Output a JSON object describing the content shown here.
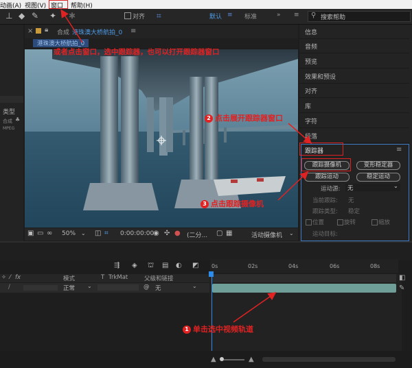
{
  "menu": {
    "animation": "动画(A)",
    "view": "视图(V)",
    "window": "窗口",
    "help": "帮助(H)"
  },
  "toolbar": {
    "align_label": "对齐",
    "workspace_default": "默认",
    "workspace_standard": "标准",
    "search_placeholder": "搜索帮助"
  },
  "project": {
    "type_label": "类型",
    "synth_label": "合成",
    "mp4_label": "MPEG"
  },
  "composition": {
    "tab_prefix": "合成",
    "tab_title": "港珠澳大桥航拍_0",
    "subtab": "港珠澳大桥航拍_0",
    "zoom": "50%",
    "timecode": "0:00:00:00",
    "resolution": "(二分...",
    "camera": "活动摄像机"
  },
  "right_panel": {
    "items": [
      "信息",
      "音频",
      "预览",
      "效果和预设",
      "对齐",
      "库",
      "字符",
      "段落"
    ],
    "tracker": {
      "title": "跟踪器",
      "btn_track_camera": "跟踪摄像机",
      "btn_warp_stabilizer": "变形稳定器",
      "btn_track_motion": "跟踪运动",
      "btn_stabilize_motion": "稳定运动",
      "motion_source_label": "运动源:",
      "motion_source_value": "无",
      "current_track_label": "当前跟踪:",
      "current_track_value": "无",
      "track_type_label": "跟踪类型:",
      "track_type_value": "稳定",
      "opt_position": "位置",
      "opt_rotation": "旋转",
      "opt_scale": "缩放",
      "motion_target_label": "运动目标:"
    }
  },
  "timeline": {
    "ruler_ticks": [
      "0s",
      "02s",
      "04s",
      "06s",
      "08s"
    ],
    "col_mode": "模式",
    "col_t": "T",
    "col_trkmat": "TrkMat",
    "col_parent": "父级和链接",
    "row_mode": "正常",
    "row_parent": "无"
  },
  "annotations": {
    "step_top": "或者点击窗口，选中跟踪器，也可以打开跟踪器窗口",
    "step1_num": "1",
    "step1": "单击选中视频轨道",
    "step2_num": "2",
    "step2": "点击展开跟踪器窗口",
    "step3_num": "3",
    "step3": "点击跟踪摄像机"
  },
  "colors": {
    "annotation": "#e02222",
    "accent_blue": "#2d8ceb",
    "clip_teal": "#6f9e98"
  }
}
